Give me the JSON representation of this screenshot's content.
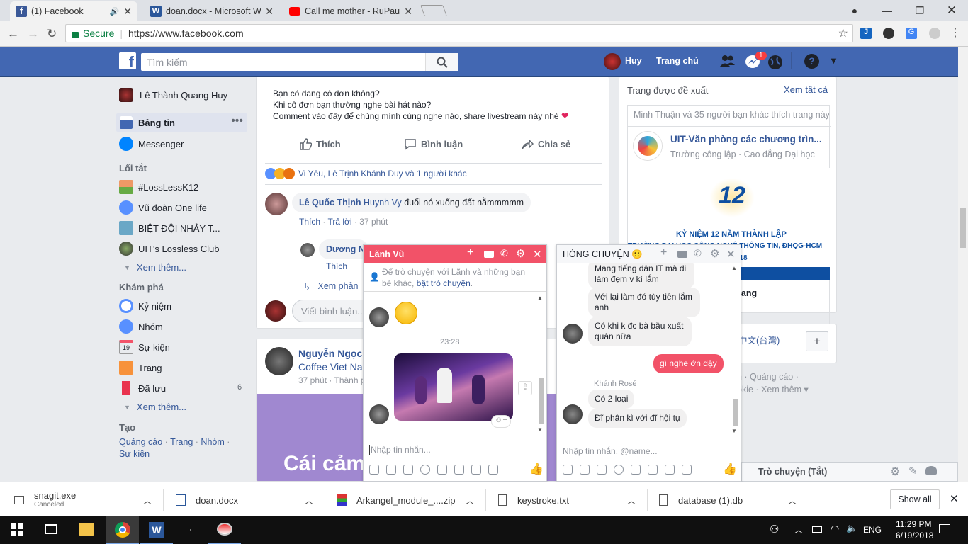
{
  "browser": {
    "tabs": [
      {
        "title": "(1) Facebook",
        "active": true
      },
      {
        "title": "doan.docx - Microsoft W"
      },
      {
        "title": "Call me mother - RuPaul"
      }
    ],
    "secure_label": "Secure",
    "url": "https://www.facebook.com"
  },
  "fb": {
    "search_placeholder": "Tìm kiếm",
    "user_short": "Huy",
    "home": "Trang chủ",
    "notif_count": "1",
    "left": {
      "profile": "Lê Thành Quang Huy",
      "news": "Bảng tin",
      "messenger": "Messenger",
      "shortcuts_title": "Lối tắt",
      "shortcuts": [
        "#LossLessK12",
        "Vũ đoàn One life",
        "BIỆT ĐỘI NHẢY T...",
        "UIT's Lossless Club"
      ],
      "see_more": "Xem thêm...",
      "explore_title": "Khám phá",
      "explore": [
        "Kỷ niệm",
        "Nhóm",
        "Sự kiện",
        "Trang",
        "Đã lưu"
      ],
      "saved_count": "6",
      "calendar_day": "19",
      "create_title": "Tạo",
      "create_links": [
        "Quảng cáo",
        "Trang",
        "Nhóm",
        "Sự kiện"
      ]
    },
    "post": {
      "lines": [
        "Bạn có đang cô đơn không?",
        "Khi cô đơn bạn thường nghe bài hát nào?",
        "Comment vào đây để chúng mình cùng nghe nào, share livestream này nhé"
      ],
      "like": "Thích",
      "comment": "Bình luận",
      "share": "Chia sẻ",
      "reactions": "Vi Yêu, Lê Trịnh Khánh Duy và 1 người khác",
      "c1_author": "Lê Quốc Thịnh",
      "c1_mention": "Huynh Vy",
      "c1_text": "đuổi nó xuống đất nằmmmmm",
      "c1_like": "Thích",
      "c1_reply": "Trả lời",
      "c1_time": "37 phút",
      "c2_author": "Dương N",
      "c2_like": "Thích",
      "see_replies": "Xem phản",
      "write_comment": "Viết bình luận..."
    },
    "post2": {
      "author": "Nguyễn Ngọc",
      "page": "Coffee Viet Na",
      "time": "37 phút",
      "visibility": "Thành p",
      "big_text": "Cái cảm"
    },
    "right": {
      "suggest_title": "Trang được đề xuất",
      "see_all": "Xem tất cả",
      "friends_like": "Minh Thuận và 35 người bạn khác thích trang này",
      "page_name": "UIT-Văn phòng các chương trìn...",
      "page_desc": "Trường công lập · Cao đẳng Đại học",
      "banner_num": "12",
      "banner_title": "KỶ NIỆM 12 NĂM THÀNH LẬP",
      "banner_sub": "TRƯỜNG ĐẠI HỌC CÔNG NGHỆ THÔNG TIN, ĐHQG-HCM",
      "banner_date": "6.2018",
      "page_short": "rang",
      "lang": "中文(台灣)",
      "plus": "+",
      "footer1": "n · Quảng cáo ·",
      "footer2": "okie · Xem thêm ▾",
      "chat_bar": "Trò chuyện (Tắt)"
    }
  },
  "chat1": {
    "name": "Lãnh Vũ",
    "hint": "Để trò chuyện với Lãnh và những bạn bè khác,",
    "hint_link": "bật trò chuyện",
    "hint_end": ".",
    "time": "23:28",
    "input": "Nhập tin nhắn..."
  },
  "chat2": {
    "name": "HÓNG CHUYỆN 🙂",
    "m1": "Mang tiếng dân IT mà đi làm đẹm v kì lắm",
    "m2": "Với lại làm đó tùy tiền lắm anh",
    "m3": "Có khi k đc bà bầu xuất quân nữa",
    "m4": "gì nghe ớn dậy",
    "sender": "Khánh Rosé",
    "m5": "Có 2 loại",
    "m6": "Đĩ phân kì với đĩ hội tụ",
    "input": "Nhập tin nhắn, @name..."
  },
  "downloads": {
    "items": [
      {
        "name": "snagit.exe",
        "status": "Canceled"
      },
      {
        "name": "doan.docx"
      },
      {
        "name": "Arkangel_module_....zip"
      },
      {
        "name": "keystroke.txt"
      },
      {
        "name": "database (1).db"
      }
    ],
    "show_all": "Show all"
  },
  "taskbar": {
    "time": "11:29 PM",
    "date": "6/19/2018",
    "lang": "ENG"
  },
  "colors": {
    "fb_blue": "#4267b2",
    "messenger_pink": "#f25268",
    "like_blue": "#4080ff"
  }
}
